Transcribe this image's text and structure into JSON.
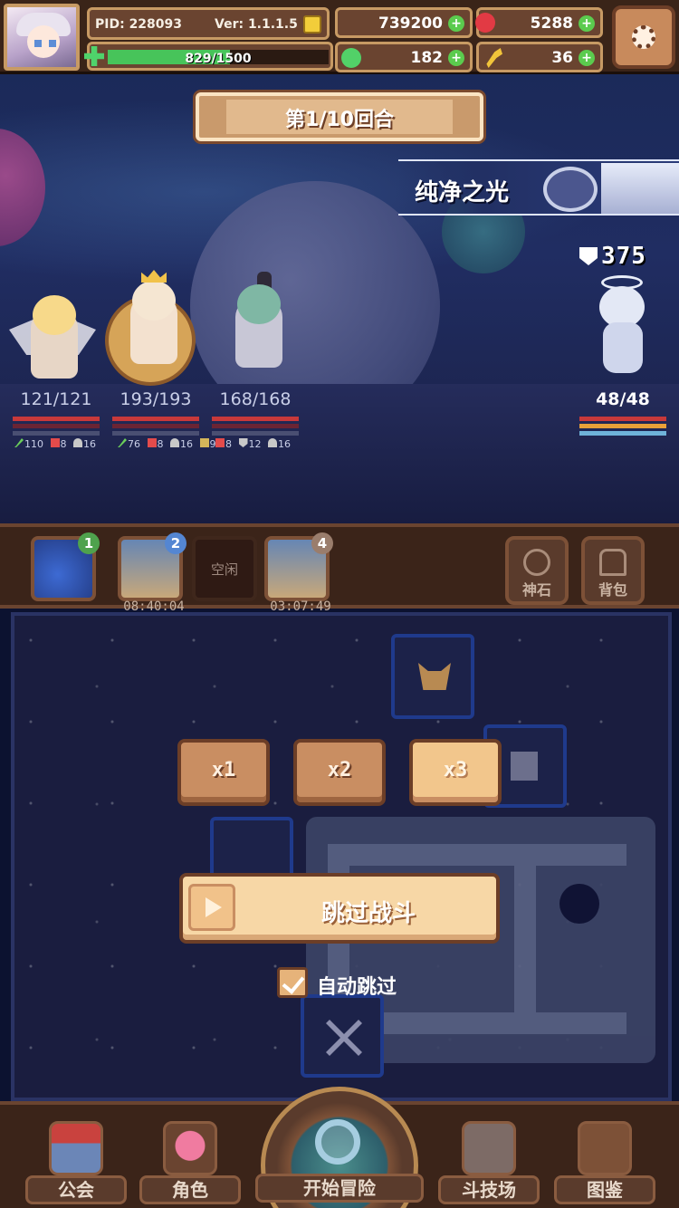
{
  "header": {
    "pid": "PID: 228093",
    "version": "Ver: 1.1.1.5",
    "exp_text": "829/1500",
    "exp_fraction": 0.553,
    "gold": "739200",
    "gems": "5288",
    "clovers": "182",
    "keys": "36",
    "plus": "+"
  },
  "battle": {
    "round": "第1/10回合",
    "enemy_name": "纯净之光",
    "enemy_power": "375",
    "heroes": [
      {
        "hp": "121/121",
        "stats": [
          "110",
          "8",
          "16"
        ]
      },
      {
        "hp": "193/193",
        "stats": [
          "76",
          "8",
          "16",
          "9"
        ]
      },
      {
        "hp": "168/168",
        "stats": [
          "8",
          "12",
          "16"
        ]
      }
    ],
    "enemy_hp": "48/48"
  },
  "slots": [
    {
      "num": "1"
    },
    {
      "num": "2",
      "timer": "08:40:04"
    },
    {
      "label": "空闲"
    },
    {
      "num": "4",
      "timer": "03:07:49"
    }
  ],
  "side_buttons": {
    "godstone": "神石",
    "bag": "背包"
  },
  "speed": {
    "x1": "x1",
    "x2": "x2",
    "x3": "x3"
  },
  "skip_button": "跳过战斗",
  "auto_skip": "自动跳过",
  "nav": {
    "guild": "公会",
    "role": "角色",
    "adventure": "开始冒险",
    "arena": "斗技场",
    "codex": "图鉴"
  },
  "colors": {
    "hp_red": "#c8393a",
    "exp_green": "#47c45a",
    "wood": "#6a4430",
    "button_cream": "#f7d7a6"
  }
}
